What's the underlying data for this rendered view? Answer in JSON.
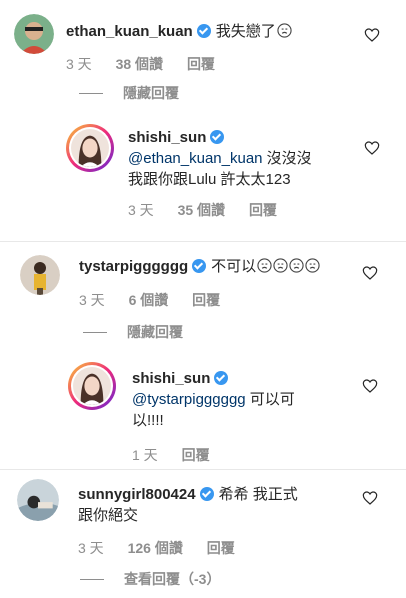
{
  "comments": [
    {
      "username": "ethan_kuan_kuan",
      "text": "我失戀了",
      "time": "3 天",
      "likes": "38 個讚",
      "reply_label": "回覆",
      "toggle": "隱藏回覆",
      "replies": [
        {
          "username": "shishi_sun",
          "mention": "@ethan_kuan_kuan",
          "text_line1": " 沒沒沒",
          "text_line2": "我跟你跟Lulu 許太太123",
          "time": "3 天",
          "likes": "35 個讚",
          "reply_label": "回覆"
        }
      ]
    },
    {
      "username": "tystarpigggggg",
      "text": "不可以",
      "time": "3 天",
      "likes": "6 個讚",
      "reply_label": "回覆",
      "toggle": "隱藏回覆",
      "replies": [
        {
          "username": "shishi_sun",
          "mention": "@tystarpigggggg",
          "text_line1": " 可以可",
          "text_line2": "以!!!!",
          "time": "1 天",
          "reply_label": "回覆"
        }
      ]
    },
    {
      "username": "sunnygirl800424",
      "text_line1": "希希 我正式",
      "text_line2": "跟你絕交",
      "time": "3 天",
      "likes": "126 個讚",
      "reply_label": "回覆",
      "toggle": "查看回覆（-3）"
    }
  ],
  "icons": {
    "verified": "verified-badge-icon",
    "heart": "heart-outline-icon",
    "emoji": "crying-face-emoji"
  },
  "colors": {
    "verified": "#3897f0",
    "mention": "#003569",
    "meta": "#8e8e8e"
  }
}
